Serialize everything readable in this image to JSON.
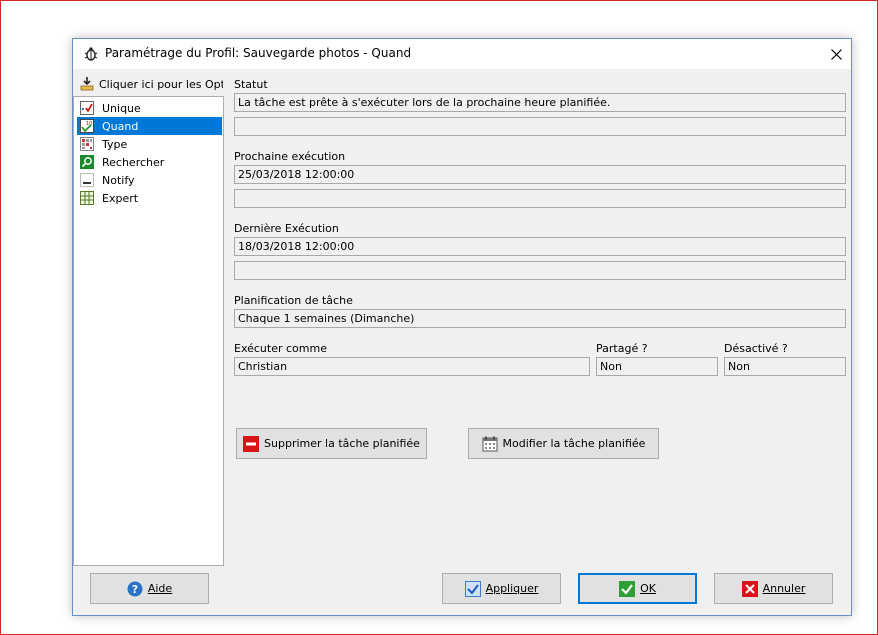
{
  "window": {
    "title": "Paramétrage du Profil: Sauvegarde photos - Quand",
    "app_icon": "bug-gear-icon",
    "close_icon": "close-icon"
  },
  "sidebar": {
    "header_label": "Cliquer ici pour les Opti",
    "items": [
      {
        "label": "Unique",
        "icon": "checklist-icon",
        "selected": false
      },
      {
        "label": "Quand",
        "icon": "calendar-icon",
        "selected": true
      },
      {
        "label": "Type",
        "icon": "grid-icon",
        "selected": false
      },
      {
        "label": "Rechercher",
        "icon": "search-icon",
        "selected": false
      },
      {
        "label": "Notify",
        "icon": "notify-icon",
        "selected": false
      },
      {
        "label": "Expert",
        "icon": "table-icon",
        "selected": false
      }
    ]
  },
  "status": {
    "label": "Statut",
    "value": "La tâche est prête à s'exécuter lors de la prochaine heure planifiée.",
    "extra": ""
  },
  "next_run": {
    "label": "Prochaine exécution",
    "value": "25/03/2018 12:00:00",
    "extra": ""
  },
  "last_run": {
    "label": "Dernière Exécution",
    "value": "18/03/2018 12:00:00",
    "extra": ""
  },
  "schedule": {
    "label": "Planification de tâche",
    "value": "Chaque 1 semaines (Dimanche)"
  },
  "run_as": {
    "label": "Exécuter comme",
    "value": "Christian"
  },
  "shared": {
    "label": "Partagé ?",
    "value": "Non"
  },
  "disabled": {
    "label": "Désactivé ?",
    "value": "Non"
  },
  "actions": {
    "delete_label": "Supprimer la tâche planifiée",
    "modify_label": "Modifier la tâche planifiée"
  },
  "footer": {
    "help_label": "Aide",
    "apply_label": "Appliquer",
    "ok_label": "OK",
    "cancel_label": "Annuler"
  },
  "colors": {
    "selection": "#0078d7",
    "dialog_bg": "#f0f0f0",
    "screen_border": "#d9262b"
  }
}
